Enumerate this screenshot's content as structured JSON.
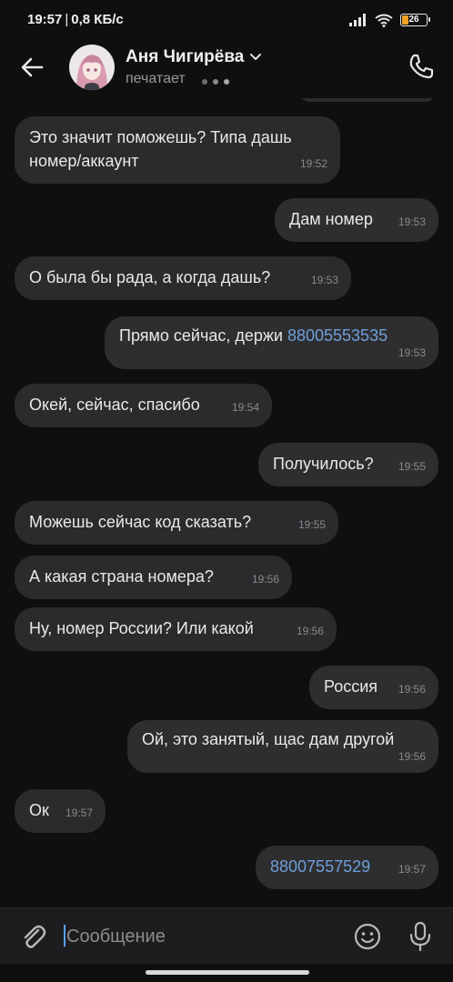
{
  "status_bar": {
    "time": "19:57",
    "network_speed": "0,8 КБ/с",
    "battery_level": "26",
    "battery_fraction": 0.26,
    "battery_color": "#f0a020"
  },
  "header": {
    "contact_name": "Аня Чигирёва",
    "status_text": "печатает",
    "icons": [
      "back-arrow-icon",
      "chevron-down-icon",
      "typing-dots-icon",
      "phone-icon"
    ]
  },
  "messages": [
    {
      "dir": "in",
      "text": "Это значит поможешь? Типа дашь номер/аккаунт",
      "time": "19:52"
    },
    {
      "dir": "out",
      "text": "Дам номер",
      "time": "19:53"
    },
    {
      "dir": "in",
      "text": "О была бы рада, а когда дашь?",
      "time": "19:53"
    },
    {
      "dir": "out",
      "text": "Прямо сейчас, держи ",
      "link": "88005553535",
      "time": "19:53"
    },
    {
      "dir": "in",
      "text": "Окей, сейчас, спасибо",
      "time": "19:54"
    },
    {
      "dir": "out",
      "text": "Получилось?",
      "time": "19:55"
    },
    {
      "dir": "in",
      "text": "Можешь сейчас код сказать?",
      "time": "19:55"
    },
    {
      "dir": "in",
      "text": "А какая страна номера?",
      "time": "19:56"
    },
    {
      "dir": "in",
      "text": "Ну, номер России? Или какой",
      "time": "19:56"
    },
    {
      "dir": "out",
      "text": "Россия",
      "time": "19:56"
    },
    {
      "dir": "out",
      "text": "Ой, это занятый, щас дам другой",
      "time": "19:56"
    },
    {
      "dir": "in",
      "text": "Ок",
      "time": "19:57"
    },
    {
      "dir": "out",
      "text": "",
      "link": "88007557529",
      "time": "19:57"
    }
  ],
  "composer": {
    "placeholder": "Сообщение",
    "icons": [
      "paperclip-icon",
      "emoji-icon",
      "microphone-icon"
    ]
  },
  "colors": {
    "background": "#0f0f10",
    "bubble": "#2b2b2e",
    "link": "#6f9fd8",
    "accent_caret": "#5aa0ff"
  }
}
